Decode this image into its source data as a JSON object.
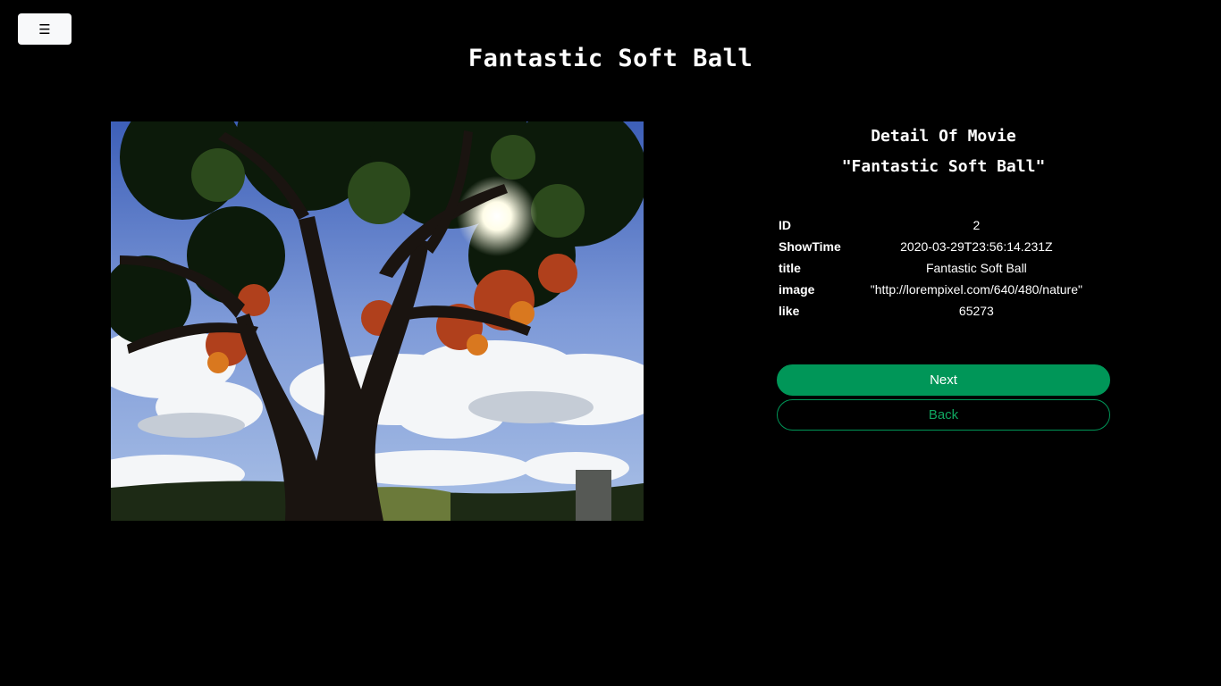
{
  "menu": {
    "icon": "hamburger-menu-icon",
    "glyph": "☰"
  },
  "title": "Fantastic Soft Ball",
  "photo": {
    "subject": "tree-under-sky-image"
  },
  "detail": {
    "heading": "Detail Of Movie",
    "movie_title": "\"Fantastic Soft Ball\"",
    "rows": [
      {
        "key": "ID",
        "value": "2"
      },
      {
        "key": "ShowTime",
        "value": "2020-03-29T23:56:14.231Z"
      },
      {
        "key": "title",
        "value": "Fantastic Soft Ball"
      },
      {
        "key": "image",
        "value": "\"http://lorempixel.com/640/480/nature\""
      },
      {
        "key": "like",
        "value": "65273"
      }
    ]
  },
  "buttons": {
    "next": "Next",
    "back": "Back"
  },
  "colors": {
    "background": "#000000",
    "accent": "#009658"
  }
}
